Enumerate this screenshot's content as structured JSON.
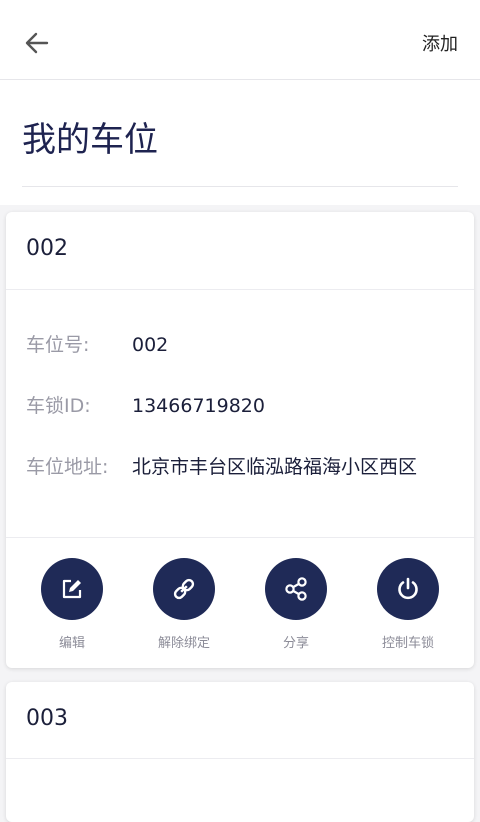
{
  "appbar": {
    "back_icon": "arrow-left-icon",
    "add_label": "添加"
  },
  "page": {
    "title": "我的车位"
  },
  "cards": [
    {
      "name": "002",
      "fields": [
        {
          "label": "车位号:",
          "value": "002"
        },
        {
          "label": "车锁ID:",
          "value": "13466719820"
        },
        {
          "label": "车位地址:",
          "value": "北京市丰台区临泓路福海小区西区"
        }
      ],
      "actions": [
        {
          "label": "编辑",
          "icon": "edit-icon"
        },
        {
          "label": "解除绑定",
          "icon": "link-icon"
        },
        {
          "label": "分享",
          "icon": "share-icon"
        },
        {
          "label": "控制车锁",
          "icon": "power-icon"
        }
      ]
    },
    {
      "name": "003"
    }
  ],
  "colors": {
    "accent": "#1f2a57",
    "label": "#9a9aa6",
    "text": "#1b1f3a"
  }
}
